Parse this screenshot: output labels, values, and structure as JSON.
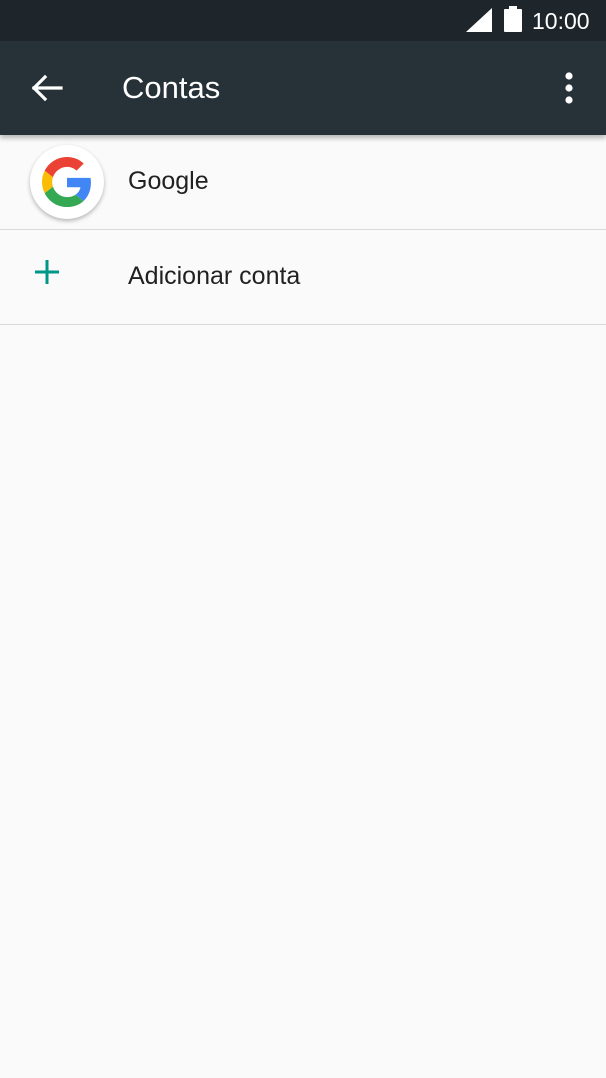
{
  "status_bar": {
    "time": "10:00",
    "icons": [
      "signal-icon",
      "battery-icon"
    ]
  },
  "app_bar": {
    "title": "Contas",
    "icons": [
      "back-arrow-icon",
      "more-vert-icon"
    ]
  },
  "accounts": [
    {
      "label": "Google",
      "icon": "google-icon"
    }
  ],
  "add_account": {
    "label": "Adicionar conta",
    "icon": "add-icon"
  },
  "colors": {
    "status_bar": "#1f262b",
    "app_bar": "#263238",
    "background": "#fafafa",
    "accent": "#009688",
    "text": "#212121",
    "divider": "#d9d9d9"
  }
}
